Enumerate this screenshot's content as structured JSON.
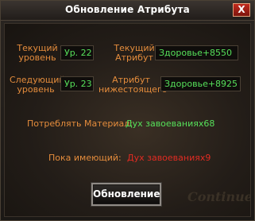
{
  "dialog": {
    "title": "Обновление Атрибута",
    "close_label": "X"
  },
  "current": {
    "level_label_line1": "Текущий",
    "level_label_line2": "уровень",
    "level_value": "Ур. 22",
    "attr_label_line1": "Текущий",
    "attr_label_line2": "Атрибут",
    "attr_value": "Здоровье+8550"
  },
  "next": {
    "level_label_line1": "Следующий",
    "level_label_line2": "уровень",
    "level_value": "Ур. 23",
    "attr_label_line1": "Атрибут",
    "attr_label_line2": "нижестоящего",
    "attr_value": "Здоровье+8925"
  },
  "cost": {
    "label": "Потреблять Материал:",
    "value": "Дух завоеваниях68"
  },
  "owned": {
    "label": "Пока имеющий:",
    "value": "Дух завоеваниях9"
  },
  "upgrade_button": "Обновление",
  "watermark": "Continue",
  "colors": {
    "accent_orange": "#e48c3c",
    "value_green": "#56e05a",
    "insufficient_red": "#e12b22",
    "close_red": "#c12a1d"
  }
}
